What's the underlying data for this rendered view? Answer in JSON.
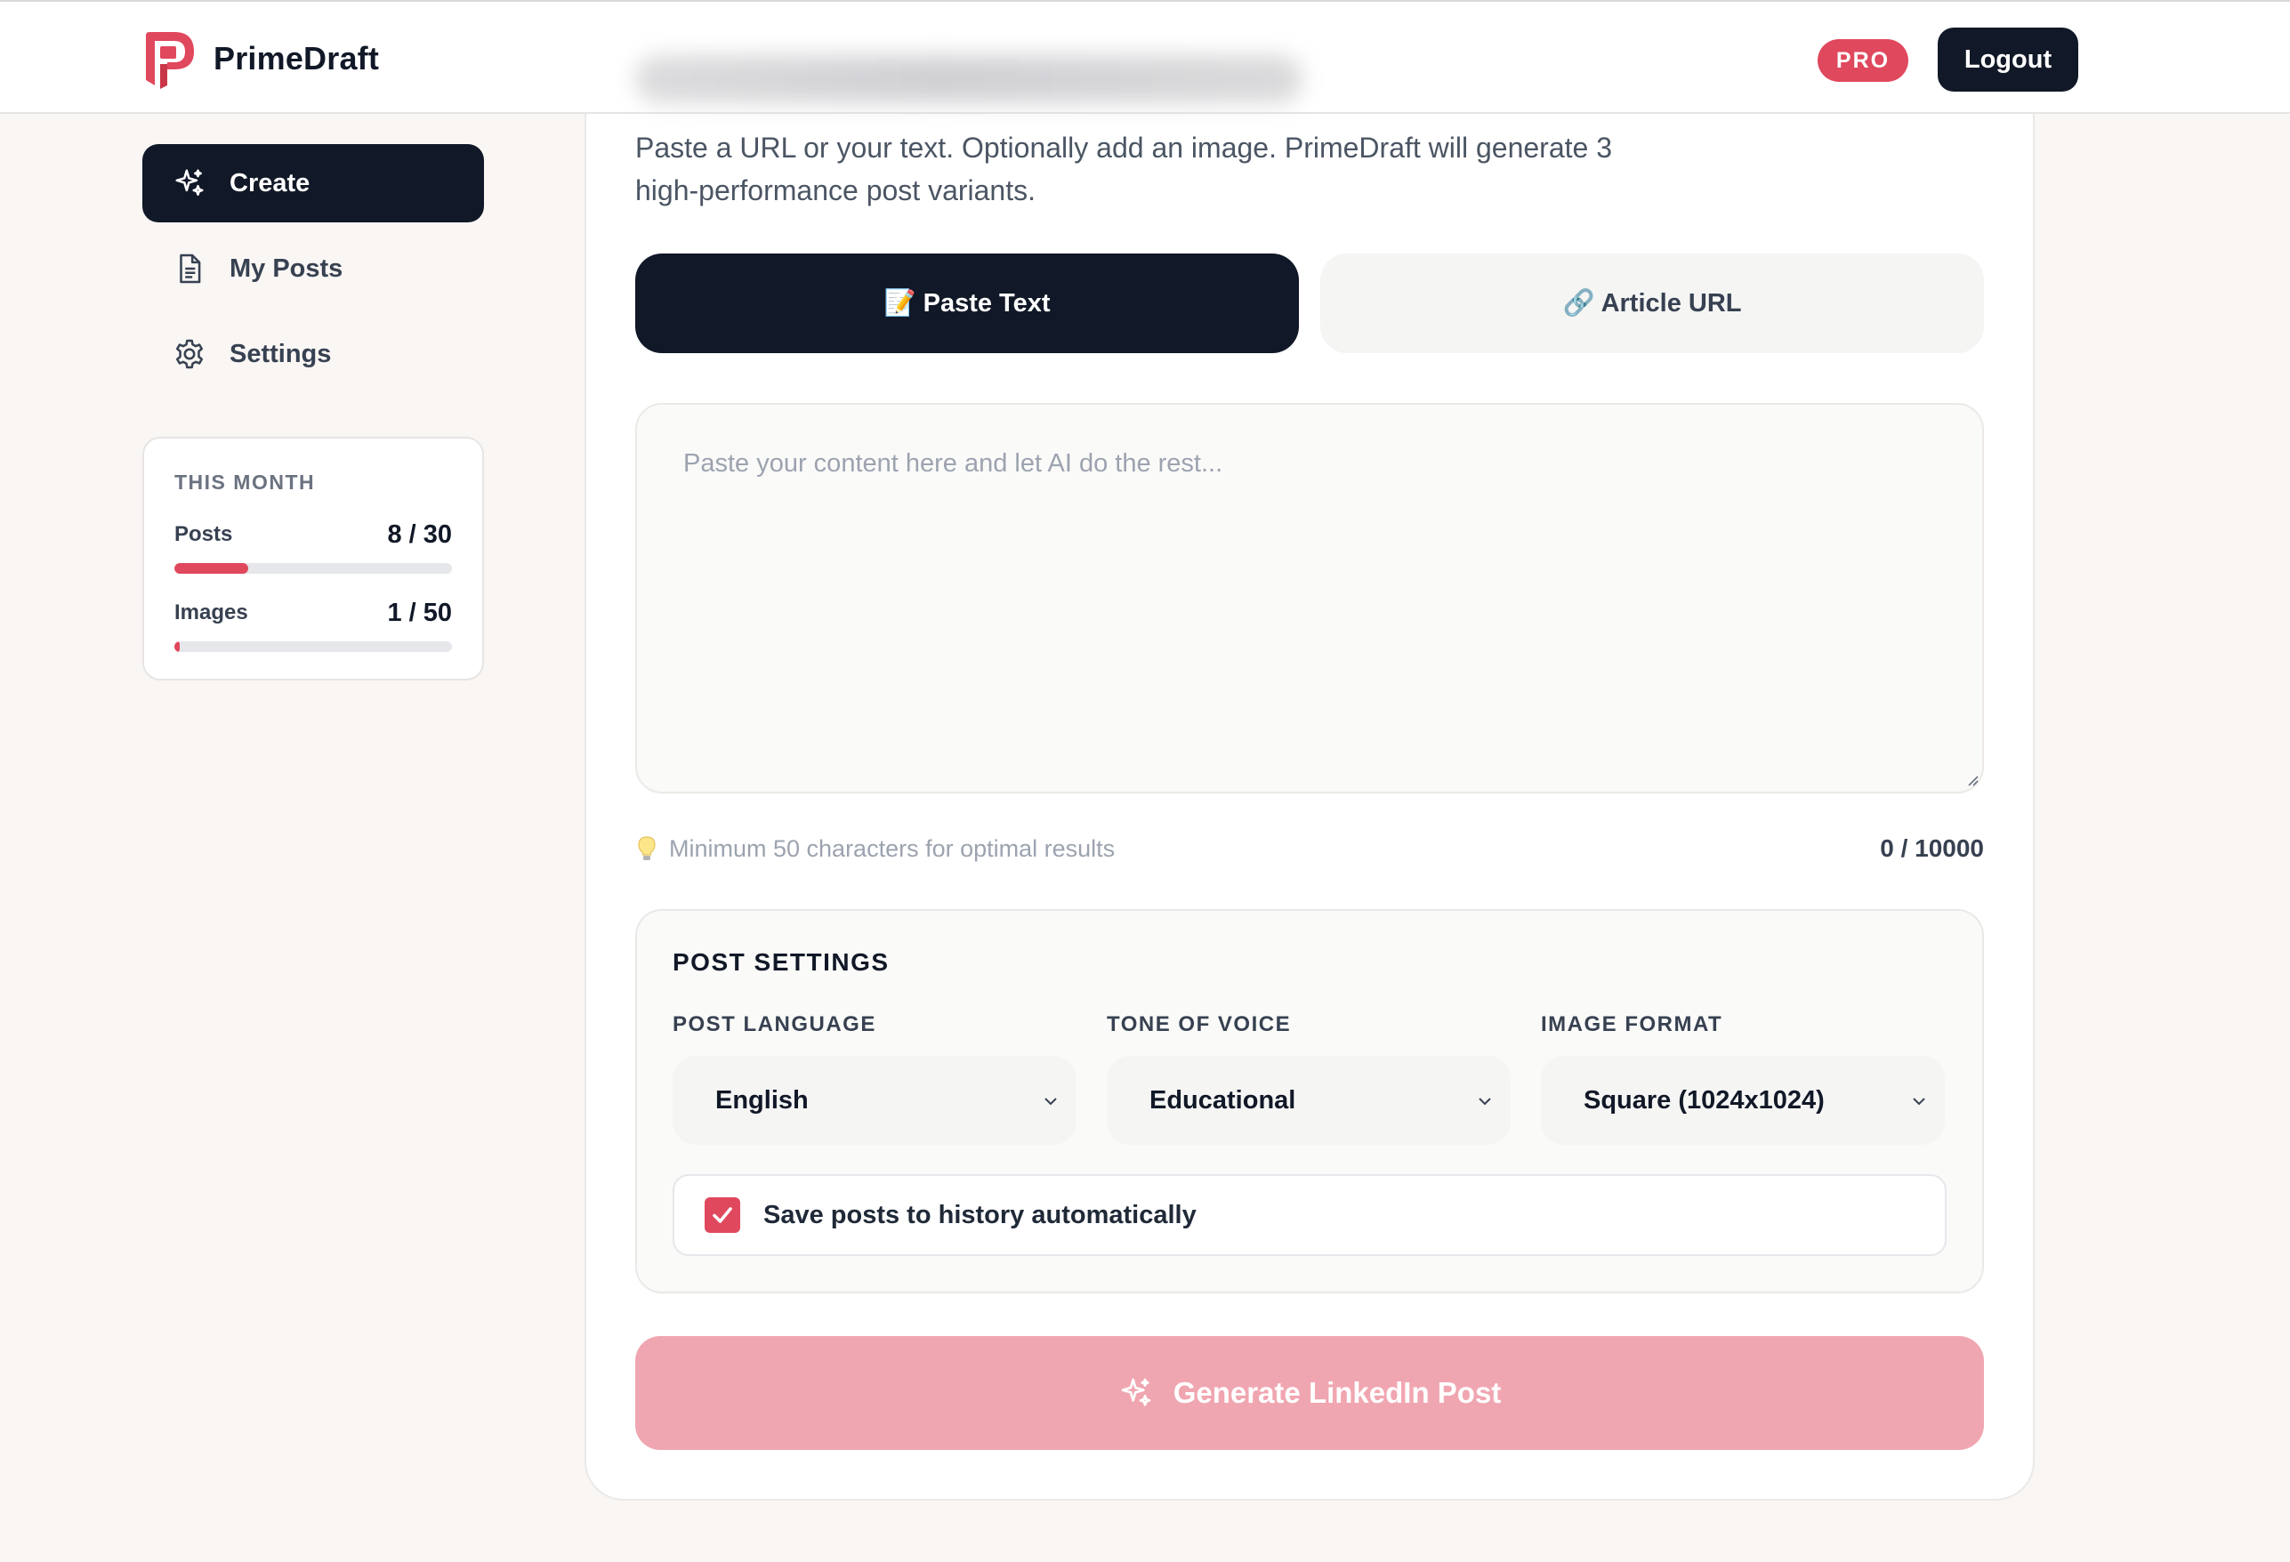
{
  "header": {
    "brand_name": "PrimeDraft",
    "pro_badge": "PRO",
    "logout_label": "Logout"
  },
  "sidebar": {
    "items": [
      {
        "label": "Create",
        "icon": "sparkles-icon",
        "active": true
      },
      {
        "label": "My Posts",
        "icon": "document-icon",
        "active": false
      },
      {
        "label": "Settings",
        "icon": "gear-icon",
        "active": false
      }
    ],
    "stats": {
      "heading": "THIS MONTH",
      "posts": {
        "label": "Posts",
        "value": "8 / 30",
        "fraction": 0.267
      },
      "images": {
        "label": "Images",
        "value": "1 / 50",
        "fraction": 0.02
      }
    }
  },
  "main": {
    "intro": "Paste a URL or your text. Optionally add an image. PrimeDraft will generate 3 high-performance post variants.",
    "tabs": [
      {
        "label": "📝 Paste Text",
        "active": true
      },
      {
        "label": "🔗 Article URL",
        "active": false
      }
    ],
    "content_input": {
      "value": "",
      "placeholder": "Paste your content here and let AI do the rest..."
    },
    "hint_text": "Minimum 50 characters for optimal results",
    "char_count": "0 / 10000",
    "settings": {
      "title": "POST SETTINGS",
      "language": {
        "label": "POST LANGUAGE",
        "value": "English"
      },
      "tone": {
        "label": "TONE OF VOICE",
        "value": "Educational"
      },
      "image_format": {
        "label": "IMAGE FORMAT",
        "value": "Square (1024x1024)"
      },
      "save_history": {
        "label": "Save posts to history automatically",
        "checked": true
      }
    },
    "generate_label": "Generate LinkedIn Post"
  },
  "colors": {
    "accent": "#e0485d",
    "dark": "#111827",
    "generate_disabled": "#f0a6b1",
    "background": "#f9f6f4"
  }
}
